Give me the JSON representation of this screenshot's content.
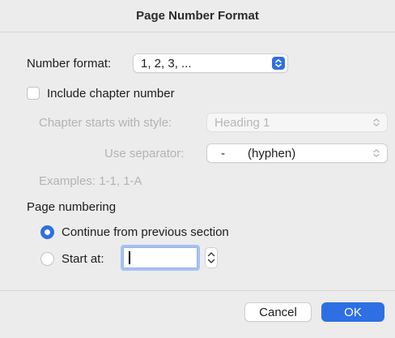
{
  "dialog": {
    "title": "Page Number Format"
  },
  "number_format": {
    "label": "Number format:",
    "value": "1, 2, 3, ..."
  },
  "include_chapter": {
    "label": "Include chapter number",
    "checked": false
  },
  "chapter_style": {
    "label": "Chapter starts with style:",
    "value": "Heading 1"
  },
  "separator": {
    "label": "Use separator:",
    "value_symbol": "-",
    "value_name": "(hyphen)"
  },
  "examples": {
    "text": "Examples: 1-1, 1-A"
  },
  "page_numbering": {
    "heading": "Page numbering",
    "continue_label": "Continue from previous section",
    "start_label": "Start at:",
    "start_value": "",
    "selected": "continue"
  },
  "buttons": {
    "cancel": "Cancel",
    "ok": "OK"
  },
  "colors": {
    "accent": "#2f6fe4",
    "background": "#ececec"
  }
}
